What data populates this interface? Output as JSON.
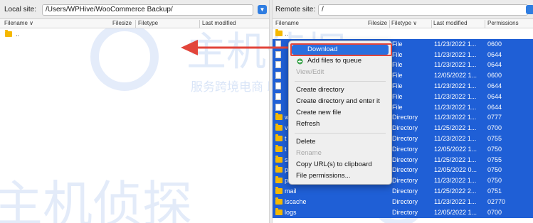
{
  "local": {
    "site_label": "Local site:",
    "path": "/Users/WPHive/WooCommerce Backup/",
    "columns": [
      "Filename",
      "Filesize",
      "Filetype",
      "Last modified"
    ],
    "filename_sort": "Filename ∨",
    "rows": [
      {
        "name": ".."
      }
    ]
  },
  "remote": {
    "site_label": "Remote site:",
    "path": "/",
    "columns": [
      "Filename",
      "Filesize",
      "Filetype ∨",
      "Last modified",
      "Permissions"
    ],
    "rows": [
      {
        "name": "..",
        "type": "",
        "modified": "",
        "perm": "",
        "icon": "folder",
        "selected": false
      },
      {
        "name": "",
        "type": "File",
        "modified": "11/23/2022 1...",
        "perm": "0600",
        "icon": "file",
        "selected": true
      },
      {
        "name": "",
        "type": "File",
        "modified": "11/23/2022 1...",
        "perm": "0644",
        "icon": "file",
        "selected": true
      },
      {
        "name": "",
        "type": "File",
        "modified": "11/23/2022 1...",
        "perm": "0644",
        "icon": "file",
        "selected": true
      },
      {
        "name": "",
        "type": "File",
        "modified": "12/05/2022 1...",
        "perm": "0600",
        "icon": "file",
        "selected": true
      },
      {
        "name": "",
        "type": "File",
        "modified": "11/23/2022 1...",
        "perm": "0644",
        "icon": "file",
        "selected": true
      },
      {
        "name": "",
        "type": "File",
        "modified": "11/23/2022 1...",
        "perm": "0644",
        "icon": "file",
        "selected": true
      },
      {
        "name": "",
        "type": "File",
        "modified": "11/23/2022 1...",
        "perm": "0644",
        "icon": "file",
        "selected": true
      },
      {
        "name": "w",
        "type": "Directory",
        "modified": "11/23/2022 1...",
        "perm": "0777",
        "icon": "folder",
        "selected": true
      },
      {
        "name": "v",
        "type": "Directory",
        "modified": "11/25/2022 1...",
        "perm": "0700",
        "icon": "folder",
        "selected": true
      },
      {
        "name": "t",
        "type": "Directory",
        "modified": "11/23/2022 1...",
        "perm": "0755",
        "icon": "folder",
        "selected": true
      },
      {
        "name": "t",
        "type": "Directory",
        "modified": "12/05/2022 1...",
        "perm": "0750",
        "icon": "folder",
        "selected": true
      },
      {
        "name": "s",
        "type": "Directory",
        "modified": "11/25/2022 1...",
        "perm": "0755",
        "icon": "folder",
        "selected": true
      },
      {
        "name": "p",
        "type": "Directory",
        "modified": "12/05/2022 0...",
        "perm": "0750",
        "icon": "folder",
        "selected": true
      },
      {
        "name": "p",
        "type": "Directory",
        "modified": "11/23/2022 1...",
        "perm": "0750",
        "icon": "folder",
        "selected": true
      },
      {
        "name": "mail",
        "type": "Directory",
        "modified": "11/25/2022 2...",
        "perm": "0751",
        "icon": "folder",
        "selected": true
      },
      {
        "name": "lscache",
        "type": "Directory",
        "modified": "11/23/2022 1...",
        "perm": "02770",
        "icon": "folder",
        "selected": true
      },
      {
        "name": "logs",
        "type": "Directory",
        "modified": "12/05/2022 1...",
        "perm": "0700",
        "icon": "folder",
        "selected": true
      }
    ]
  },
  "context_menu": {
    "items": [
      {
        "label": "Download",
        "state": "highlighted"
      },
      {
        "label": "Add files to queue",
        "state": "enabled"
      },
      {
        "label": "View/Edit",
        "state": "disabled"
      },
      {
        "label": "Create directory",
        "state": "enabled"
      },
      {
        "label": "Create directory and enter it",
        "state": "enabled"
      },
      {
        "label": "Create new file",
        "state": "enabled"
      },
      {
        "label": "Refresh",
        "state": "enabled"
      },
      {
        "label": "Delete",
        "state": "enabled"
      },
      {
        "label": "Rename",
        "state": "disabled"
      },
      {
        "label": "Copy URL(s) to clipboard",
        "state": "enabled"
      },
      {
        "label": "File permissions...",
        "state": "enabled"
      }
    ]
  },
  "watermark": {
    "text_cn_large": "主机侦探",
    "text_cn_small": "服务跨境电商 助力中企出海"
  },
  "colors": {
    "selection": "#1f5fd6",
    "menu_highlight": "#2a6fde",
    "annotation_red": "#e2453b",
    "folder": "#f5b800",
    "watermark": "#2f6fd6"
  }
}
